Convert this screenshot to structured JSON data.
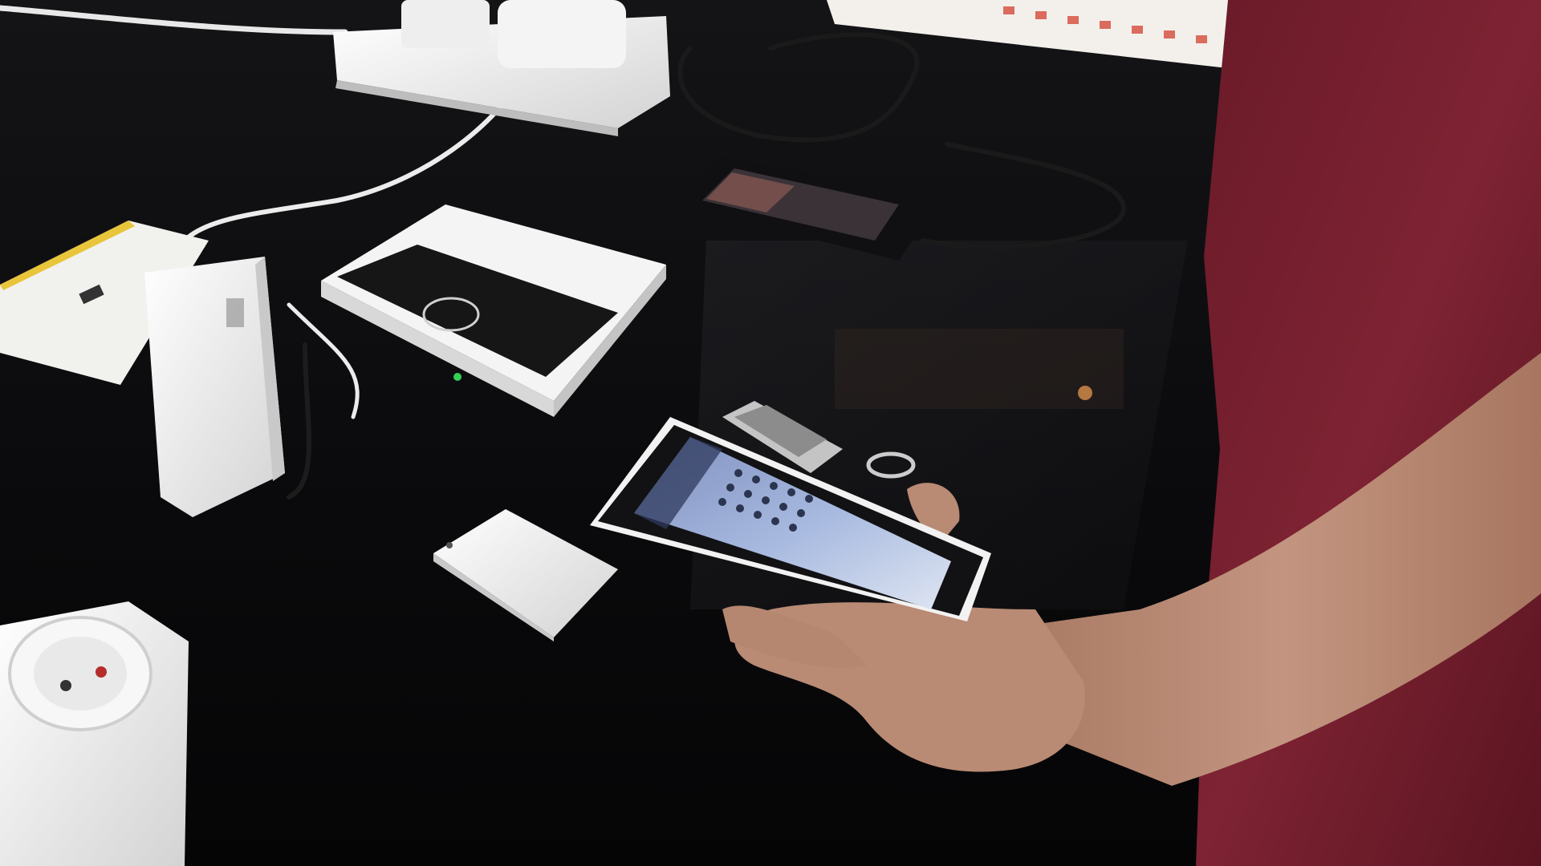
{
  "scene": {
    "description_label": "",
    "colors": {
      "tabletop": "#0b0b0d",
      "tabletop_reflection": "#232327",
      "device_white": "#eeeeee",
      "device_black": "#161616",
      "shirt": "#7a1f2e",
      "skin": "#b88a72",
      "phone_screen": "#9fb2d8",
      "status_led": "#34d058",
      "box_red_print": "#d64a3a"
    },
    "objects": [
      {
        "name": "power-strip",
        "icon": "power-strip"
      },
      {
        "name": "smart-home-hub",
        "icon": "hub"
      },
      {
        "name": "plug-in-power-adapter",
        "icon": "adapter"
      },
      {
        "name": "instruction-booklet",
        "icon": "booklet"
      },
      {
        "name": "door-window-sensor",
        "icon": "sensor"
      },
      {
        "name": "smart-socket",
        "icon": "socket"
      },
      {
        "name": "charging-smartphone",
        "icon": "phone"
      },
      {
        "name": "handheld-smartphone-app",
        "icon": "phone"
      },
      {
        "name": "remote-key-fob",
        "icon": "key-fob"
      },
      {
        "name": "product-box",
        "icon": "box"
      }
    ]
  }
}
